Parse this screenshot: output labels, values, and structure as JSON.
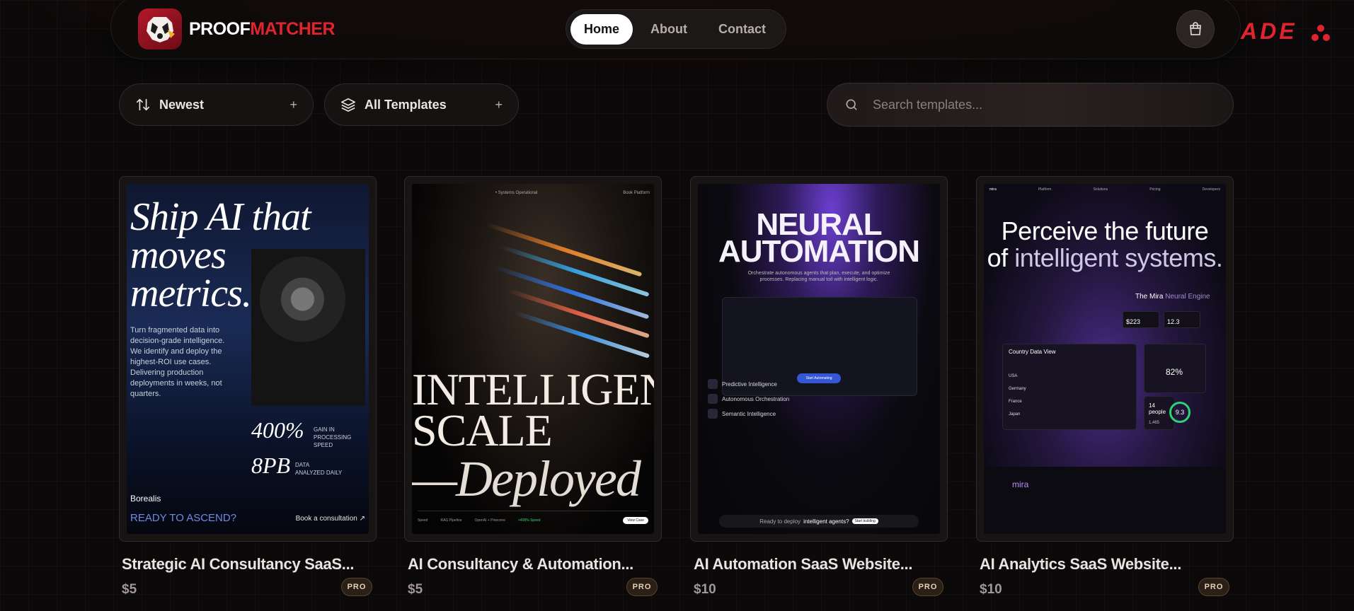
{
  "app": {
    "brand_part1": "PROOF",
    "brand_part2": "MATCHER",
    "side_text": "ADE"
  },
  "nav": {
    "links": [
      {
        "label": "Home",
        "active": true
      },
      {
        "label": "About",
        "active": false
      },
      {
        "label": "Contact",
        "active": false
      }
    ]
  },
  "filters": {
    "sort_label": "Newest",
    "category_label": "All Templates",
    "plus": "+"
  },
  "search": {
    "placeholder": "Search templates..."
  },
  "badge_label": "PRO",
  "colors": {
    "accent_red": "#e0242f",
    "background": "#0b0909",
    "badge_text": "#e6d3b3"
  },
  "cards": [
    {
      "title": "Strategic AI Consultancy SaaS...",
      "price": "$5",
      "preview": {
        "headline_1": "Ship AI that",
        "headline_2": "moves",
        "headline_3": "metrics.",
        "body": "Turn fragmented data into decision-grade intelligence. We identify and deploy the highest-ROI use cases. Delivering production deployments in weeks, not quarters.",
        "stat1_value": "400%",
        "stat1_label_1": "Gain in",
        "stat1_label_2": "processing speed",
        "stat2_value": "8PB",
        "stat2_label_1": "Data",
        "stat2_label_2": "analyzed daily",
        "brand": "Borealis",
        "cta": "READY TO ASCEND?",
        "book": "Book a consultation ↗"
      }
    },
    {
      "title": "AI Consultancy & Automation...",
      "price": "$5",
      "preview": {
        "top_note": "• Systems Operational",
        "top_right": "Book Platform",
        "line1": "INTELLIGENT",
        "line2": "SCALE",
        "line3": "—Deployed",
        "info": [
          "Speed",
          "RAG Pipeline",
          "OpenAI + Pinecone",
          "+400% Speed"
        ],
        "view_case": "View Case"
      }
    },
    {
      "title": "AI Automation SaaS Website...",
      "price": "$10",
      "preview": {
        "line1": "NEURAL",
        "line2": "AUTOMATION",
        "sub": "Orchestrate autonomous agents that plan, execute, and optimize processes. Replacing manual toil with intelligent logic.",
        "button": "Start Automating",
        "features": [
          "Predictive Intelligence",
          "Autonomous Orchestration",
          "Semantic Intelligence"
        ],
        "bottom_text": "Ready to deploy",
        "bottom_emph": "intelligent agents?",
        "bottom_pill": "Start building"
      }
    },
    {
      "title": "AI Analytics SaaS Website...",
      "price": "$10",
      "preview": {
        "logo": "mira",
        "nav": [
          "Platform",
          "Solutions",
          "Pricing",
          "Developers"
        ],
        "line1": "Perceive the future",
        "line2_a": "of ",
        "line2_b": "intelligent systems.",
        "engine_a": "The Mira ",
        "engine_b": "Neural Engine",
        "stat1": "$223",
        "stat2": "12.3",
        "panel_title": "Country Data View",
        "countries": [
          "USA",
          "Germany",
          "France",
          "Japan"
        ],
        "gauge": "82%",
        "people": "14 people",
        "people_sub": "1,465",
        "ring": "9.3",
        "footer_logo": "mira"
      }
    }
  ]
}
